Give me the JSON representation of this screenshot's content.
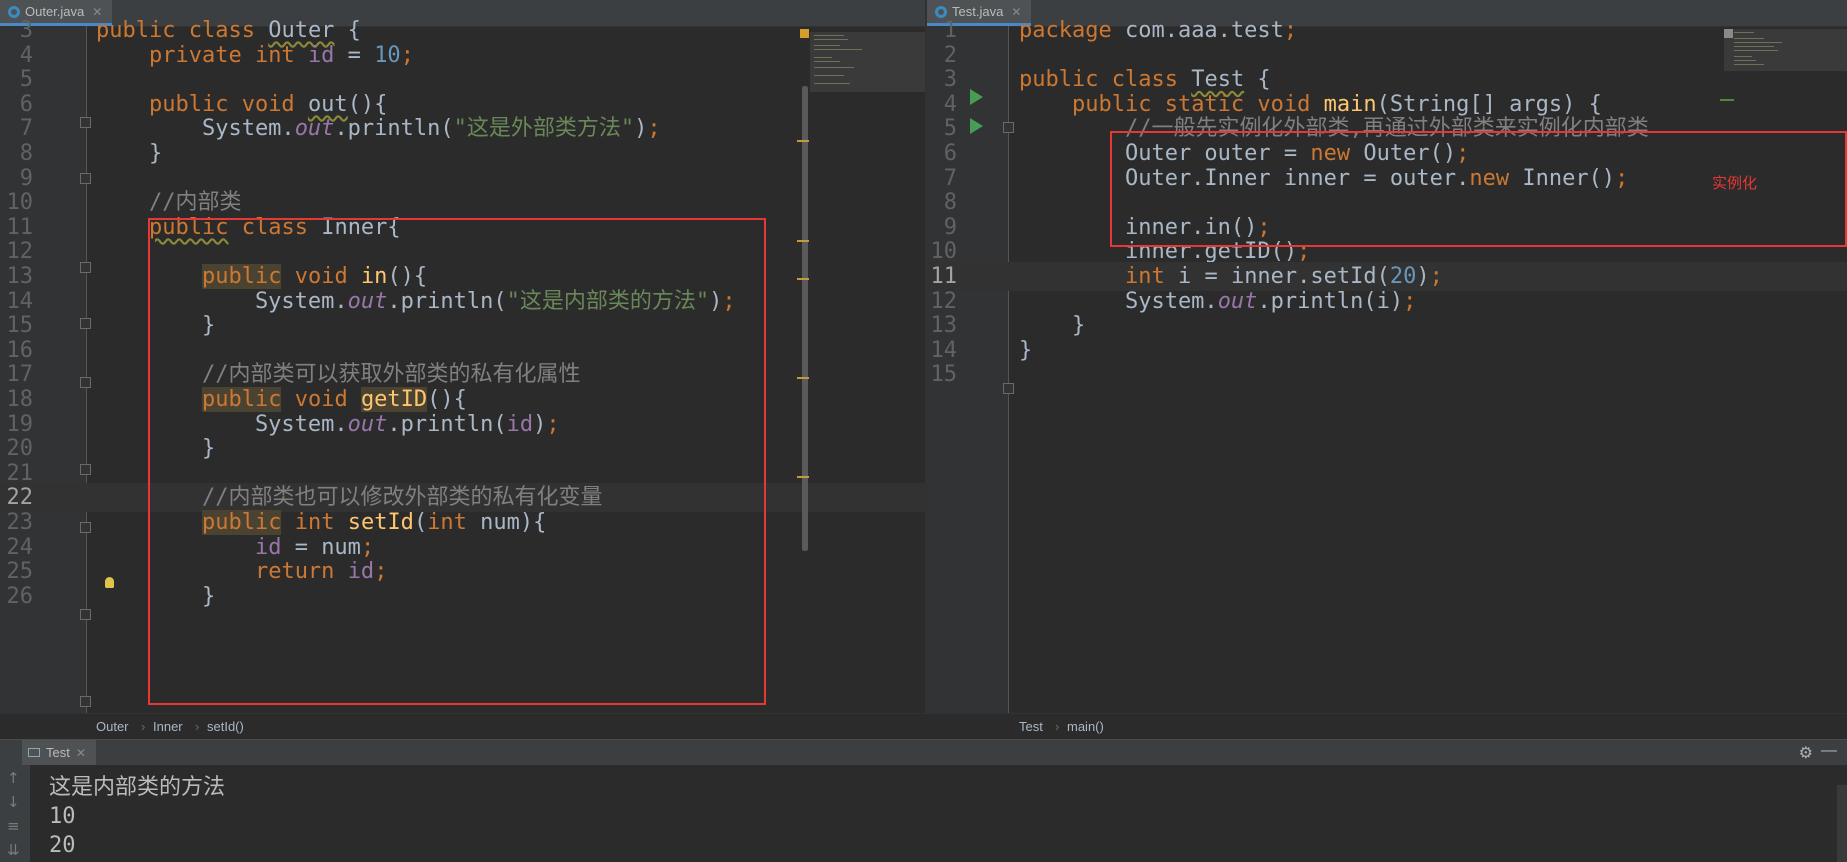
{
  "left_editor": {
    "tab_label": "Outer.java",
    "breadcrumb": [
      "Outer",
      "Inner",
      "setId()"
    ],
    "lines": [
      {
        "n": "3",
        "html": "<span class=\"kw\">public class</span> <span class=\"wavy\">Outer</span> {"
      },
      {
        "n": "4",
        "html": "    <span class=\"kw\">private int</span> <span class=\"fld\">id</span> = <span class=\"num\">10</span><span class=\"kw\">;</span>"
      },
      {
        "n": "5",
        "html": ""
      },
      {
        "n": "6",
        "html": "    <span class=\"kw\">public void</span> <span class=\"wavy\">out</span>(){"
      },
      {
        "n": "7",
        "html": "        System.<span class=\"stat\">out</span>.println(<span class=\"str\">\"这是外部类方法\"</span>)<span class=\"kw\">;</span>"
      },
      {
        "n": "8",
        "html": "    }"
      },
      {
        "n": "9",
        "html": ""
      },
      {
        "n": "10",
        "html": "    <span class=\"cm\">//内部类</span>"
      },
      {
        "n": "11",
        "html": "    <span class=\"kw wavy\">public</span> <span class=\"kw\">class</span> Inner{"
      },
      {
        "n": "12",
        "html": ""
      },
      {
        "n": "13",
        "html": "        <span class=\"kw hl\">public</span> <span class=\"kw\">void</span> <span class=\"fn\">in</span>(){"
      },
      {
        "n": "14",
        "html": "            System.<span class=\"stat\">out</span>.println(<span class=\"str\">\"这是内部类的方法\"</span>)<span class=\"kw\">;</span>"
      },
      {
        "n": "15",
        "html": "        }"
      },
      {
        "n": "16",
        "html": ""
      },
      {
        "n": "17",
        "html": "        <span class=\"cm\">//内部类可以获取外部类的私有化属性</span>"
      },
      {
        "n": "18",
        "html": "        <span class=\"kw hl\">public</span> <span class=\"kw\">void</span> <span class=\"fn hl\">getID</span>(){"
      },
      {
        "n": "19",
        "html": "            System.<span class=\"stat\">out</span>.println(<span class=\"fld\">id</span>)<span class=\"kw\">;</span>"
      },
      {
        "n": "20",
        "html": "        }"
      },
      {
        "n": "21",
        "html": ""
      },
      {
        "n": "22",
        "html": "        <span class=\"cm\">//内部类也可以修改外部类的私有化变量</span>"
      },
      {
        "n": "23",
        "html": "        <span class=\"kw hl\">public</span> <span class=\"kw\">int</span> <span class=\"fn\">setId</span>(<span class=\"kw\">int</span> num){"
      },
      {
        "n": "24",
        "html": "            <span class=\"fld\">id</span> = num<span class=\"kw\">;</span>"
      },
      {
        "n": "25",
        "html": "            <span class=\"kw\">return</span> <span class=\"fld\">id</span><span class=\"kw\">;</span>"
      },
      {
        "n": "26",
        "html": "        }"
      }
    ]
  },
  "right_editor": {
    "tab_label": "Test.java",
    "breadcrumb": [
      "Test",
      "main()"
    ],
    "annotation": "实例化",
    "lines": [
      {
        "n": "1",
        "html": "<span class=\"kw\">package</span> com.aaa.test<span class=\"kw\">;</span>"
      },
      {
        "n": "2",
        "html": ""
      },
      {
        "n": "3",
        "html": "<span class=\"kw\">public class</span> <span class=\"wavy\">Test</span> {"
      },
      {
        "n": "4",
        "html": "    <span class=\"kw\">public static void</span> <span class=\"fn\">main</span>(String[] args) {"
      },
      {
        "n": "5",
        "html": "        <span class=\"cm\">//一般先实例化外部类,再通过外部类来实例化内部类</span>"
      },
      {
        "n": "6",
        "html": "        Outer outer = <span class=\"kw\">new</span> Outer()<span class=\"kw\">;</span>"
      },
      {
        "n": "7",
        "html": "        Outer.Inner inner = outer.<span class=\"kw\">new</span> Inner()<span class=\"kw\">;</span>"
      },
      {
        "n": "8",
        "html": ""
      },
      {
        "n": "9",
        "html": "        inner.in()<span class=\"kw\">;</span>"
      },
      {
        "n": "10",
        "html": "        inner.getID()<span class=\"kw\">;</span>"
      },
      {
        "n": "11",
        "html": "        <span class=\"kw\">int</span> i = inner.setId(<span class=\"num\">20</span>)<span class=\"kw\">;</span>"
      },
      {
        "n": "12",
        "html": "        System.<span class=\"stat\">out</span>.println(i)<span class=\"kw\">;</span>"
      },
      {
        "n": "13",
        "html": "    }"
      },
      {
        "n": "14",
        "html": "}"
      },
      {
        "n": "15",
        "html": ""
      }
    ]
  },
  "run_panel": {
    "tab_label": "Test",
    "output": [
      "这是内部类的方法",
      "10",
      "20"
    ]
  }
}
